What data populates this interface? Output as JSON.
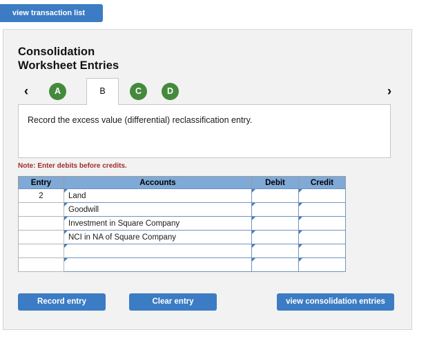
{
  "colors": {
    "button_blue": "#3b7cc4",
    "tab_green": "#458a3c",
    "table_header_blue": "#7fa9d6",
    "cell_border_blue": "#6f93bd",
    "note_red": "#a32b2b",
    "panel_bg": "#f2f2f2"
  },
  "toolbar": {
    "view_transaction_list_label": "view transaction list"
  },
  "header": {
    "title": "Consolidation\nWorksheet Entries"
  },
  "tabs": {
    "prev_arrow": "‹",
    "next_arrow": "›",
    "items": [
      {
        "label": "A",
        "state": "complete"
      },
      {
        "label": "B",
        "state": "active"
      },
      {
        "label": "C",
        "state": "complete"
      },
      {
        "label": "D",
        "state": "complete"
      }
    ]
  },
  "instruction": {
    "text": "Record the excess value (differential) reclassification entry."
  },
  "note": {
    "text": "Note: Enter debits before credits."
  },
  "table": {
    "columns": [
      "Entry",
      "Accounts",
      "Debit",
      "Credit"
    ],
    "rows": [
      {
        "entry": "2",
        "account": "Land",
        "debit": "",
        "credit": ""
      },
      {
        "entry": "",
        "account": "Goodwill",
        "debit": "",
        "credit": ""
      },
      {
        "entry": "",
        "account": "Investment in Square Company",
        "debit": "",
        "credit": ""
      },
      {
        "entry": "",
        "account": "NCI in NA of Square Company",
        "debit": "",
        "credit": ""
      },
      {
        "entry": "",
        "account": "",
        "debit": "",
        "credit": ""
      },
      {
        "entry": "",
        "account": "",
        "debit": "",
        "credit": ""
      }
    ]
  },
  "actions": {
    "record_entry_label": "Record entry",
    "clear_entry_label": "Clear entry",
    "view_consolidation_entries_label": "view consolidation entries"
  }
}
